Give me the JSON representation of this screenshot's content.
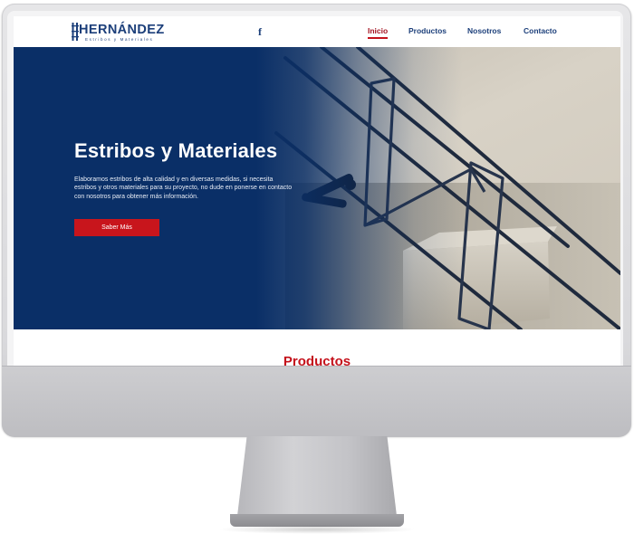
{
  "site": {
    "logo": {
      "name": "HERNÁNDEZ",
      "tagline": "Estribos y Materiales"
    },
    "social": {
      "facebook_glyph": "f",
      "icon": "facebook-icon"
    },
    "nav": [
      {
        "label": "Inicio",
        "active": true
      },
      {
        "label": "Productos",
        "active": false
      },
      {
        "label": "Nosotros",
        "active": false
      },
      {
        "label": "Contacto",
        "active": false
      }
    ],
    "hero": {
      "title": "Estribos y Materiales",
      "description": "Elaboramos estribos de alta calidad y en diversas medidas, si necesita estribos y otros materiales para su proyecto, no dude en ponerse en contacto con nosotros para obtener más información.",
      "cta_label": "Saber Más"
    },
    "products_heading": "Productos"
  },
  "colors": {
    "brand_blue": "#1c3f7a",
    "hero_blue": "#0a2f67",
    "accent_red": "#c8151c"
  }
}
